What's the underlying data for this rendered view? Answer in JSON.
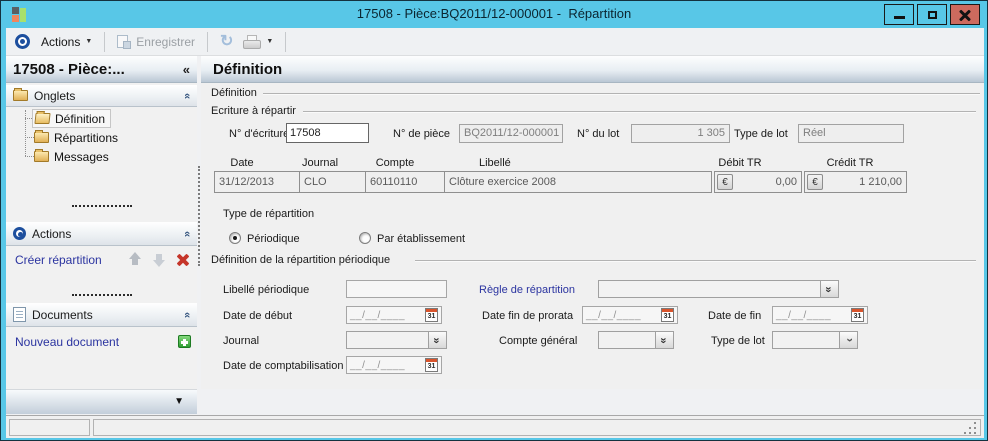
{
  "window": {
    "title": "17508 - Pièce:BQ2011/12-000001 -  Répartition"
  },
  "toolbar": {
    "actions_label": "Actions",
    "save_label": "Enregistrer",
    "refresh_glyph": "↻",
    "caret_glyph": "▼"
  },
  "sidebar": {
    "header": {
      "title": "17508 - Pièce:...",
      "collapse_glyph": "«"
    },
    "onglets": {
      "title": "Onglets",
      "collapse_glyph": "«",
      "items": [
        {
          "label": "Définition",
          "selected": true
        },
        {
          "label": "Répartitions",
          "selected": false
        },
        {
          "label": "Messages",
          "selected": false
        }
      ]
    },
    "actions": {
      "title": "Actions",
      "collapse_glyph": "«",
      "create_link": "Créer répartition"
    },
    "documents": {
      "title": "Documents",
      "collapse_glyph": "«",
      "new_link": "Nouveau document"
    },
    "scroll_down_glyph": "▼"
  },
  "main": {
    "page_title": "Définition",
    "groups": {
      "definition": "Définition",
      "ecriture": "Ecriture à répartir",
      "periodique": "Définition de la répartition périodique"
    },
    "entry": {
      "num_ecriture_label": "N° d'écriture",
      "num_ecriture_value": "17508",
      "num_piece_label": "N° de pièce",
      "num_piece_value": "BQ2011/12-000001",
      "num_lot_label": "N° du lot",
      "num_lot_value": "1 305",
      "type_lot_label": "Type de lot",
      "type_lot_value": "Réel"
    },
    "grid": {
      "headers": [
        "Date",
        "Journal",
        "Compte",
        "Libellé",
        "Débit TR",
        "Crédit TR"
      ],
      "row": {
        "date": "31/12/2013",
        "journal": "CLO",
        "compte": "60110110",
        "libelle": "Clôture exercice 2008",
        "debit": "0,00",
        "credit": "1 210,00"
      },
      "currency": "€"
    },
    "type_repartition": {
      "label": "Type de répartition",
      "options": [
        {
          "label": "Périodique",
          "selected": true
        },
        {
          "label": "Par établissement",
          "selected": false
        }
      ]
    },
    "form": {
      "libelle_periodique_label": "Libellé périodique",
      "regle_label": "Règle de répartition",
      "date_debut_label": "Date de début",
      "date_fin_prorata_label": "Date fin de prorata",
      "date_fin_label": "Date de fin",
      "journal_label": "Journal",
      "compte_general_label": "Compte général",
      "type_lot_label": "Type de lot",
      "date_compta_label": "Date de comptabilisation",
      "date_placeholder": "__/__/____",
      "calendar_glyph": "31",
      "combo_double_glyph": "«",
      "combo_single_glyph": "‹"
    }
  }
}
